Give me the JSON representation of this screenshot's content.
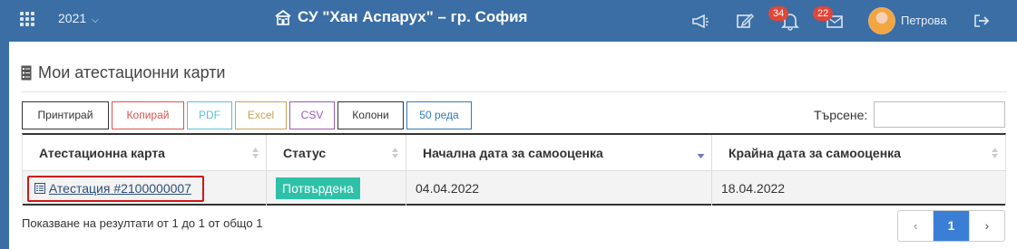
{
  "topbar": {
    "year": "2021",
    "school_title": "СУ \"Хан Аспарух\" – гр. София",
    "notifications_count": "34",
    "messages_count": "22",
    "username": "Петрова",
    "icons": [
      "apps-grid-icon",
      "chevron-down-icon",
      "school-icon",
      "megaphone-icon",
      "edit-icon",
      "bell-icon",
      "envelope-icon",
      "avatar",
      "logout-icon"
    ],
    "accent_color": "#3a6ea5"
  },
  "page": {
    "title": "Мои атестационни карти",
    "title_icon": "checklist-icon"
  },
  "toolbar": {
    "buttons": [
      {
        "label": "Принтирай",
        "color": "#333333"
      },
      {
        "label": "Копирай",
        "color": "#d9534f"
      },
      {
        "label": "PDF",
        "color": "#5bc0de"
      },
      {
        "label": "Excel",
        "color": "#c9a15a"
      },
      {
        "label": "CSV",
        "color": "#9b59b6"
      },
      {
        "label": "Колони",
        "color": "#333333"
      },
      {
        "label": "50 реда",
        "color": "#337ab7"
      }
    ],
    "search_label": "Търсене:",
    "search_value": ""
  },
  "table": {
    "columns": [
      "Атестационна карта",
      "Статус",
      "Начална дата за самооценка",
      "Крайна дата за самооценка"
    ],
    "rows": [
      {
        "card": "Атестация #2100000007",
        "status": "Потвърдена",
        "start": "04.04.2022",
        "end": "18.04.2022",
        "status_color": "#2fc1a8"
      }
    ]
  },
  "footer": {
    "info": "Показване на резултати от 1 до 1 от общо 1",
    "pager": {
      "prev": "‹",
      "current": "1",
      "next": "›"
    }
  }
}
